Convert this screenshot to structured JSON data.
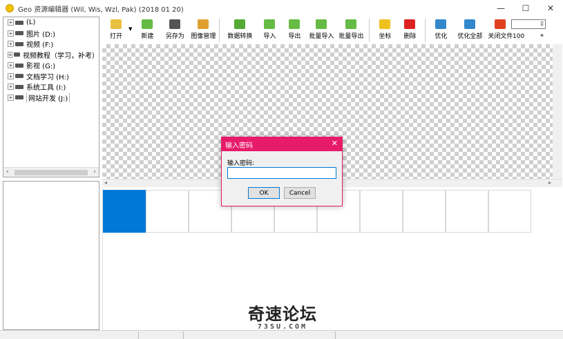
{
  "window": {
    "title": "Geo 资源编辑器 (Wil, Wis, Wzl, Pak) (2018 01 20)",
    "controls": [
      "—",
      "☐",
      "✕"
    ]
  },
  "tree": {
    "items": [
      {
        "label": "(L)",
        "type": "root"
      },
      {
        "label": "图片 (D:)"
      },
      {
        "label": "视频 (F:)"
      },
      {
        "label": "视频教程（学习，补考）"
      },
      {
        "label": "影视 (G:)"
      },
      {
        "label": "文档学习 (H:)"
      },
      {
        "label": "系统工具 (I:)"
      },
      {
        "label": "网站开发 (J:)",
        "selected": true
      }
    ],
    "expander": "+"
  },
  "toolbar": {
    "buttons": [
      {
        "label": "打开",
        "icon": "folder-open-icon",
        "color": "#e8c040",
        "dropdown": true
      },
      {
        "label": "新建",
        "icon": "new-icon",
        "color": "#66bb44"
      },
      {
        "label": "另存为",
        "icon": "save-as-icon",
        "color": "#555555"
      },
      {
        "label": "图像管理",
        "icon": "image-manage-icon",
        "color": "#e0a030"
      },
      {
        "label": "数据转换",
        "icon": "convert-icon",
        "color": "#55aa33"
      },
      {
        "label": "导入",
        "icon": "import-icon",
        "color": "#66bb44"
      },
      {
        "label": "导出",
        "icon": "export-icon",
        "color": "#66bb44"
      },
      {
        "label": "批量导入",
        "icon": "batch-import-icon",
        "color": "#66bb44"
      },
      {
        "label": "批量导出",
        "icon": "batch-export-icon",
        "color": "#66bb44"
      },
      {
        "label": "坐标",
        "icon": "star-icon",
        "color": "#f0c020"
      },
      {
        "label": "删除",
        "icon": "delete-icon",
        "color": "#dd2222"
      },
      {
        "label": "优化",
        "icon": "optimize-icon",
        "color": "#3388cc"
      },
      {
        "label": "优化全部",
        "icon": "optimize-all-icon",
        "color": "#3388cc"
      },
      {
        "label": "关闭文件",
        "icon": "close-file-icon",
        "color": "#e04020"
      }
    ],
    "zoom_value": "100",
    "zoom_star": "*"
  },
  "dialog": {
    "title": "输入密码",
    "close": "✕",
    "prompt": "输入密码:",
    "input_value": "",
    "ok_label": "OK",
    "cancel_label": "Cancel",
    "accent": "#e81a6a"
  },
  "thumbnails": {
    "count": 10,
    "selected_index": 0,
    "selected_color": "#0078d7"
  },
  "watermark": {
    "main": "奇速论坛",
    "sub": "73SU.COM"
  }
}
